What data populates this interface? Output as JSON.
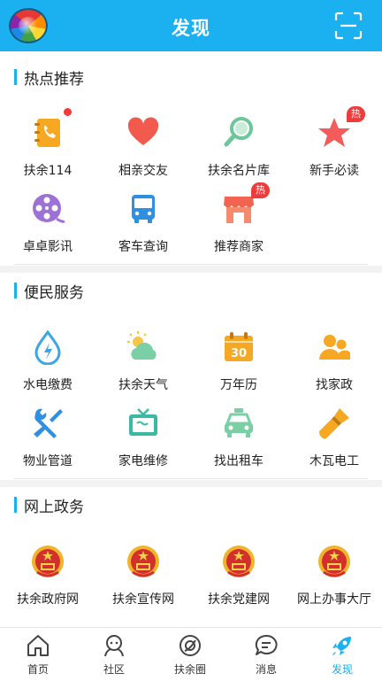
{
  "header": {
    "title": "发现"
  },
  "sections": [
    {
      "title": "热点推荐",
      "items": [
        {
          "label": "扶余114",
          "icon": "phone-book-icon"
        },
        {
          "label": "相亲交友",
          "icon": "heart-icon"
        },
        {
          "label": "扶余名片库",
          "icon": "magnifier-icon"
        },
        {
          "label": "新手必读",
          "icon": "star-icon"
        },
        {
          "label": "卓卓影讯",
          "icon": "film-reel-icon"
        },
        {
          "label": "客车查询",
          "icon": "bus-icon"
        },
        {
          "label": "推荐商家",
          "icon": "storefront-icon"
        }
      ],
      "badges": {
        "hot": "热"
      }
    },
    {
      "title": "便民服务",
      "items": [
        {
          "label": "水电缴费",
          "icon": "water-drop-icon"
        },
        {
          "label": "扶余天气",
          "icon": "weather-icon"
        },
        {
          "label": "万年历",
          "icon": "calendar-icon"
        },
        {
          "label": "找家政",
          "icon": "people-icon"
        },
        {
          "label": "物业管道",
          "icon": "tools-icon"
        },
        {
          "label": "家电维修",
          "icon": "tv-icon"
        },
        {
          "label": "找出租车",
          "icon": "taxi-icon"
        },
        {
          "label": "木瓦电工",
          "icon": "paint-brush-icon"
        }
      ],
      "calendar_day": "30"
    },
    {
      "title": "网上政务",
      "items": [
        {
          "label": "扶余政府网",
          "icon": "emblem-icon"
        },
        {
          "label": "扶余宣传网",
          "icon": "emblem-icon"
        },
        {
          "label": "扶余党建网",
          "icon": "emblem-icon"
        },
        {
          "label": "网上办事大厅",
          "icon": "emblem-icon"
        }
      ]
    }
  ],
  "tabbar": [
    {
      "label": "首页",
      "icon": "home-icon"
    },
    {
      "label": "社区",
      "icon": "community-icon"
    },
    {
      "label": "扶余圈",
      "icon": "circle-icon"
    },
    {
      "label": "消息",
      "icon": "message-icon"
    },
    {
      "label": "发现",
      "icon": "rocket-icon",
      "active": true
    }
  ],
  "colors": {
    "accent": "#1bb1f0",
    "badge": "#ee3b3b"
  }
}
